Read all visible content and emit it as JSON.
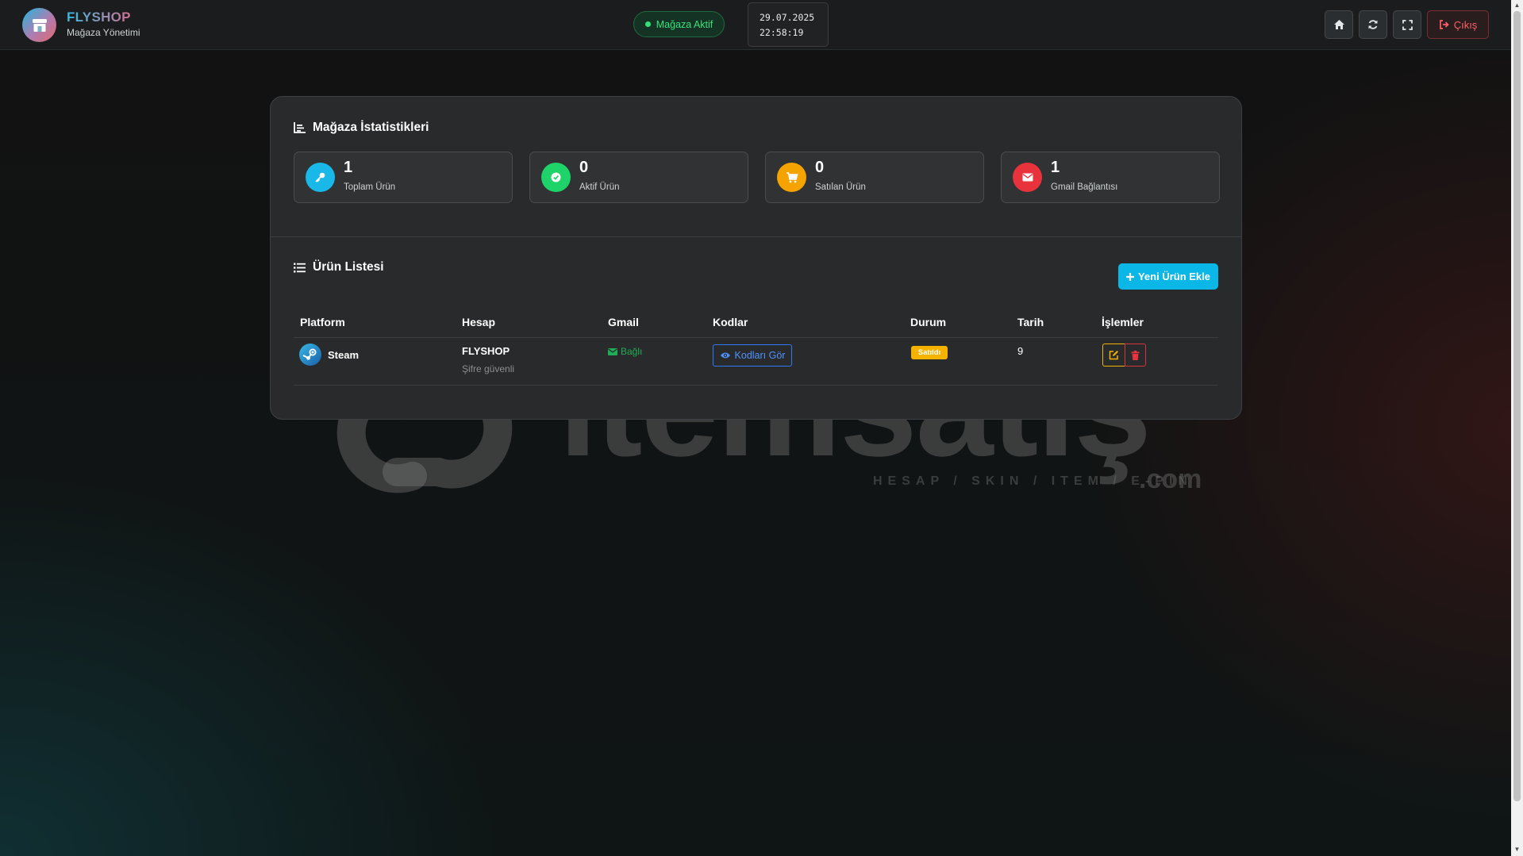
{
  "header": {
    "brand_title": "FLYSHOP",
    "brand_subtitle": "Mağaza Yönetimi",
    "status_label": "Mağaza Aktif",
    "date": "29.07.2025",
    "time": "22:58:19",
    "logout_label": "Çıkış"
  },
  "stats": {
    "title": "Mağaza İstatistikleri",
    "cards": [
      {
        "value": "1",
        "label": "Toplam Ürün",
        "icon": "key-icon",
        "color": "#1ab8e8"
      },
      {
        "value": "0",
        "label": "Aktif Ürün",
        "icon": "check-circle-icon",
        "color": "#1ed46a"
      },
      {
        "value": "0",
        "label": "Satılan Ürün",
        "icon": "cart-icon",
        "color": "#f5a300"
      },
      {
        "value": "1",
        "label": "Gmail Bağlantısı",
        "icon": "envelope-icon",
        "color": "#e8323c"
      }
    ]
  },
  "products": {
    "title": "Ürün Listesi",
    "add_button": "Yeni Ürün Ekle",
    "columns": [
      "Platform",
      "Hesap",
      "Gmail",
      "Kodlar",
      "Durum",
      "Tarih",
      "İşlemler"
    ],
    "rows": [
      {
        "platform": "Steam",
        "account": "FLYSHOP",
        "account_note": "Şifre güvenli",
        "gmail": "Bağlı",
        "codes_button": "Kodları Gör",
        "status": "Satıldı",
        "date": "9"
      }
    ]
  },
  "watermark": {
    "word": "itemsatış",
    "tagline": "HESAP / SKIN / ITEM / E-PIN",
    "suffix": ".com"
  },
  "colors": {
    "accent": "#0bb7e6",
    "success": "#35e07a",
    "warning": "#f5b300",
    "danger": "#e8323c"
  }
}
